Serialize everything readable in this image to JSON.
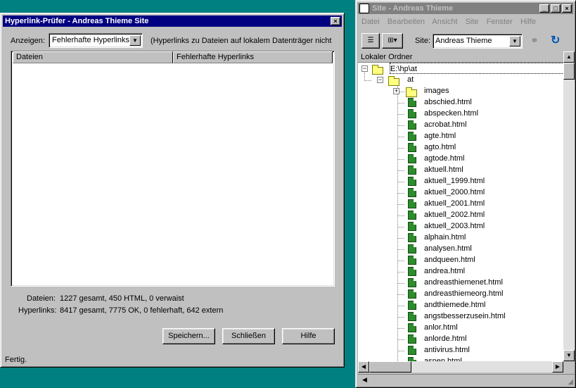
{
  "checker": {
    "title": "Hyperlink-Prüfer - Andreas Thieme Site",
    "close_glyph": "×",
    "show_label": "Anzeigen:",
    "show_select_value": "Fehlerhafte Hyperlinks",
    "show_note": "(Hyperlinks zu Dateien auf lokalem Datenträger nicht",
    "columns": [
      "Dateien",
      "Fehlerhafte Hyperlinks"
    ],
    "files_label": "Dateien:",
    "files_stats": "1227 gesamt,  450 HTML,  0 verwaist",
    "links_label": "Hyperlinks:",
    "links_stats": "8417 gesamt,  7775 OK,  0 fehlerhaft,  642 extern",
    "buttons": {
      "save": "Speichern...",
      "close": "Schließen",
      "help": "Hilfe"
    },
    "status": "Fertig."
  },
  "site": {
    "title": "Site - Andreas Thieme",
    "menu": [
      "Datei",
      "Bearbeiten",
      "Ansicht",
      "Site",
      "Fenster",
      "Hilfe"
    ],
    "site_label": "Site:",
    "site_value": "Andreas Thieme",
    "pane_header": "Lokaler Ordner",
    "root": "E:\\hp\\at",
    "folder": "at",
    "subfolder": "images",
    "files": [
      "abschied.html",
      "abspecken.html",
      "acrobat.html",
      "agte.html",
      "agto.html",
      "agtode.html",
      "aktuell.html",
      "aktuell_1999.html",
      "aktuell_2000.html",
      "aktuell_2001.html",
      "aktuell_2002.html",
      "aktuell_2003.html",
      "alphain.html",
      "analysen.html",
      "andqueen.html",
      "andrea.html",
      "andreasthiemenet.html",
      "andreasthiemeorg.html",
      "andthiemede.html",
      "angstbesserzusein.html",
      "anlor.html",
      "anlorde.html",
      "antivirus.html",
      "aspen.html"
    ]
  }
}
